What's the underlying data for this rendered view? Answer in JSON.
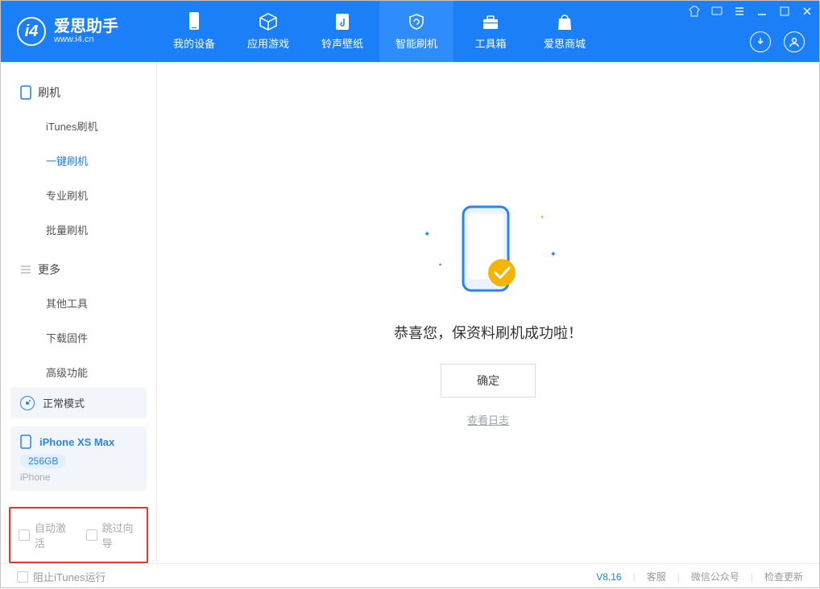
{
  "app": {
    "title": "爱思助手",
    "subtitle": "www.i4.cn"
  },
  "tabs": {
    "device": "我的设备",
    "apps": "应用游戏",
    "ringtone": "铃声壁纸",
    "flash": "智能刷机",
    "tools": "工具箱",
    "mall": "爱思商城"
  },
  "sidebar": {
    "section1": "刷机",
    "items1": [
      "iTunes刷机",
      "一键刷机",
      "专业刷机",
      "批量刷机"
    ],
    "section2": "更多",
    "items2": [
      "其他工具",
      "下载固件",
      "高级功能"
    ]
  },
  "mode": {
    "label": "正常模式"
  },
  "device": {
    "name": "iPhone XS Max",
    "storage": "256GB",
    "type": "iPhone"
  },
  "options": {
    "auto_activate": "自动激活",
    "skip_guide": "跳过向导"
  },
  "result": {
    "title": "恭喜您，保资料刷机成功啦！",
    "ok": "确定",
    "view_log": "查看日志"
  },
  "footer": {
    "block_itunes": "阻止iTunes运行",
    "version": "V8.16",
    "support": "客服",
    "wechat": "微信公众号",
    "update": "检查更新"
  }
}
